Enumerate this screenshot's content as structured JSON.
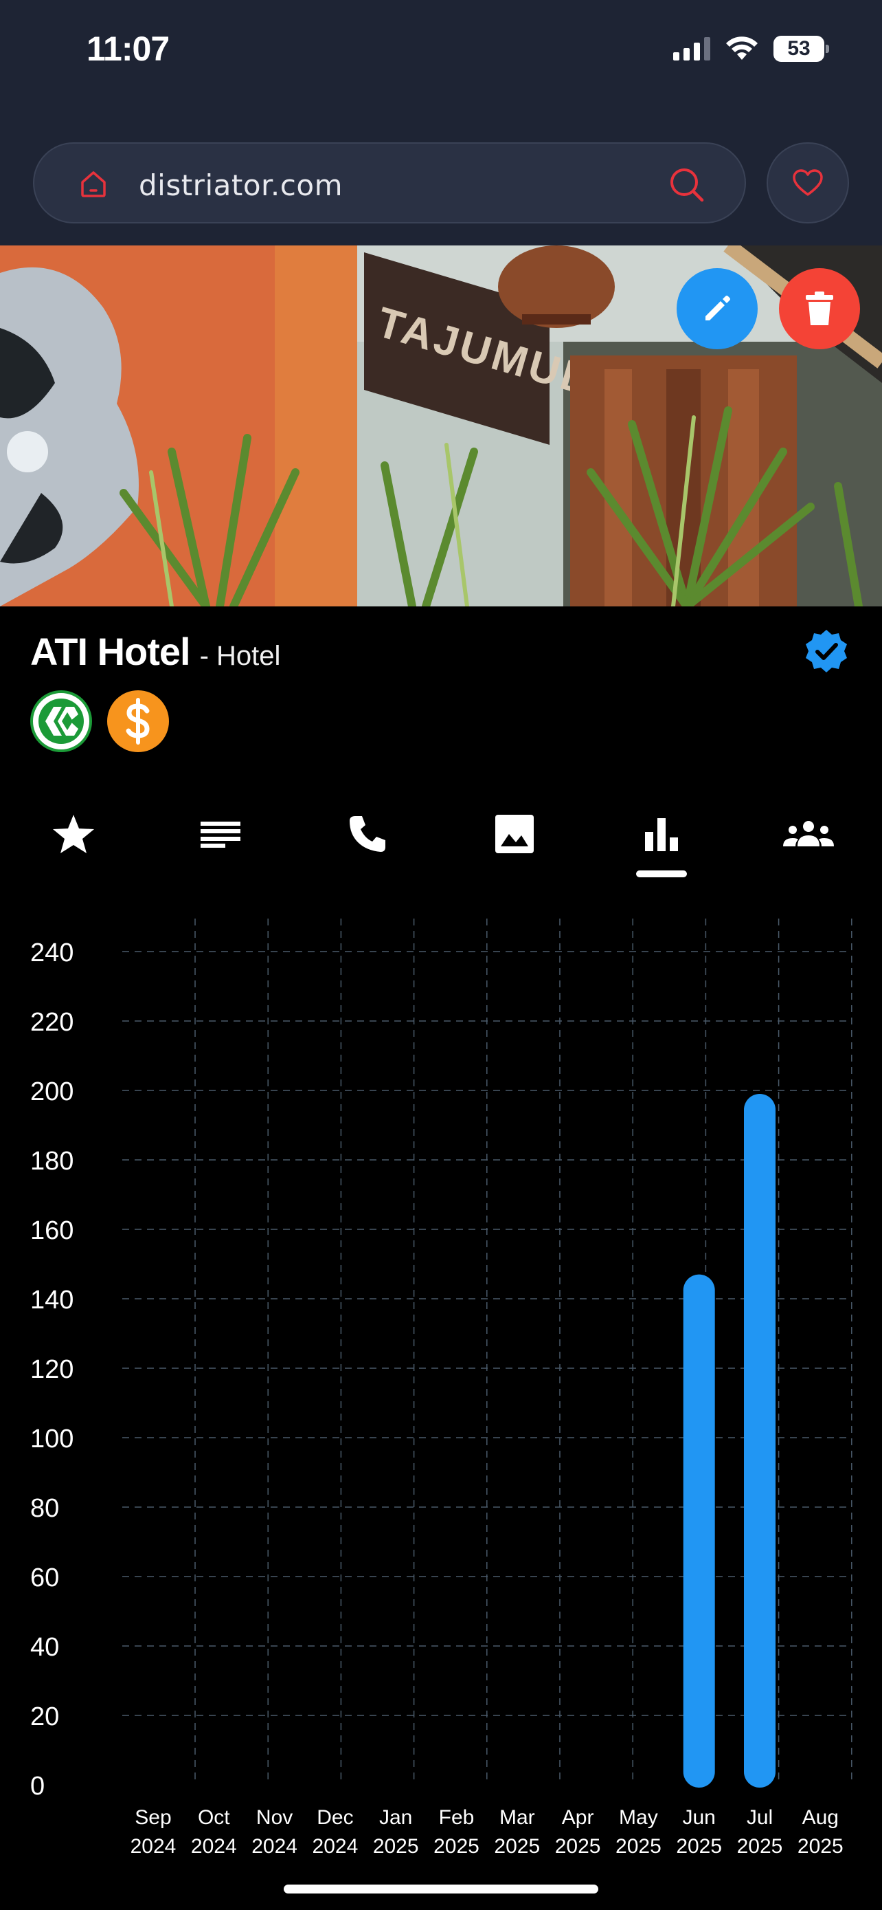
{
  "status_bar": {
    "time": "11:07",
    "battery": "53"
  },
  "browser": {
    "url": "distriator.com"
  },
  "business": {
    "name": "ATI Hotel",
    "type_suffix": "- Hotel"
  },
  "hero": {
    "sign_text": "TAJUMULCO"
  },
  "tabs": [
    {
      "icon": "star-icon",
      "active": false
    },
    {
      "icon": "text-lines-icon",
      "active": false
    },
    {
      "icon": "phone-icon",
      "active": false
    },
    {
      "icon": "image-icon",
      "active": false
    },
    {
      "icon": "bar-chart-icon",
      "active": true
    },
    {
      "icon": "group-icon",
      "active": false
    }
  ],
  "colors": {
    "accent": "#2196f3",
    "danger": "#f44336",
    "chrome": "#1e2434",
    "grid": "#4a5a6a",
    "hive_green": "#1b9a37",
    "hbd_orange": "#f7941d"
  },
  "chart_data": {
    "type": "bar",
    "categories": [
      [
        "Sep",
        "2024"
      ],
      [
        "Oct",
        "2024"
      ],
      [
        "Nov",
        "2024"
      ],
      [
        "Dec",
        "2024"
      ],
      [
        "Jan",
        "2025"
      ],
      [
        "Feb",
        "2025"
      ],
      [
        "Mar",
        "2025"
      ],
      [
        "Apr",
        "2025"
      ],
      [
        "May",
        "2025"
      ],
      [
        "Jun",
        "2025"
      ],
      [
        "Jul",
        "2025"
      ],
      [
        "Aug",
        "2025"
      ]
    ],
    "values": [
      0,
      0,
      0,
      0,
      0,
      0,
      0,
      0,
      0,
      147,
      199,
      0
    ],
    "ylim": [
      0,
      240
    ],
    "yticks": [
      0,
      20,
      40,
      60,
      80,
      100,
      120,
      140,
      160,
      180,
      200,
      220,
      240
    ],
    "grid": true,
    "bar_color": "#2196f3"
  }
}
